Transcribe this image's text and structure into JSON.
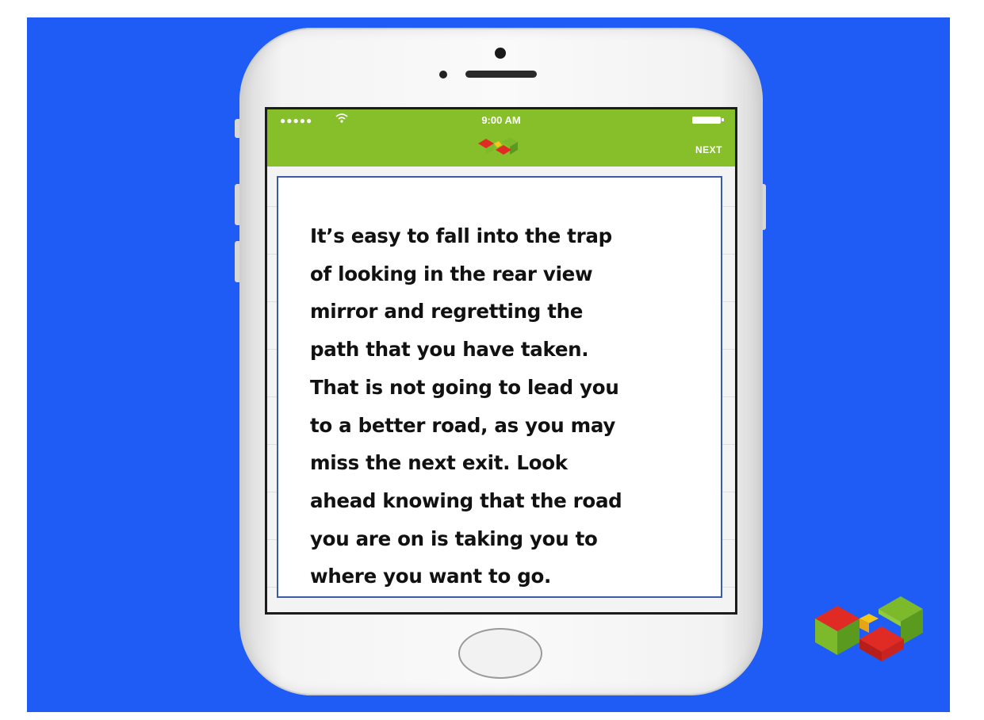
{
  "status_bar": {
    "signal": "●●●●●",
    "time": "9:00 AM",
    "wifi_icon": "wifi-icon",
    "battery_icon": "battery-icon"
  },
  "nav_bar": {
    "logo_icon": "cubes-logo-icon",
    "next_label": "NEXT",
    "color": "#86bf2a"
  },
  "quote": {
    "lines": [
      "It’s easy to fall into the trap",
      "of looking in the rear view",
      "mirror and regretting the",
      "path that you have taken.",
      "That is not going to lead you",
      "to a better road, as you may",
      "miss the next exit. Look",
      "ahead knowing that the road",
      "you are on is taking you to",
      "where you want to go."
    ]
  },
  "colors": {
    "background": "#1f5cf5",
    "card_border": "#3c5aa8",
    "logo_red": "#e02a24",
    "logo_green": "#7cba2c",
    "logo_yellow": "#f5c71a"
  },
  "brand_logo_icon": "cubes-logo-icon"
}
